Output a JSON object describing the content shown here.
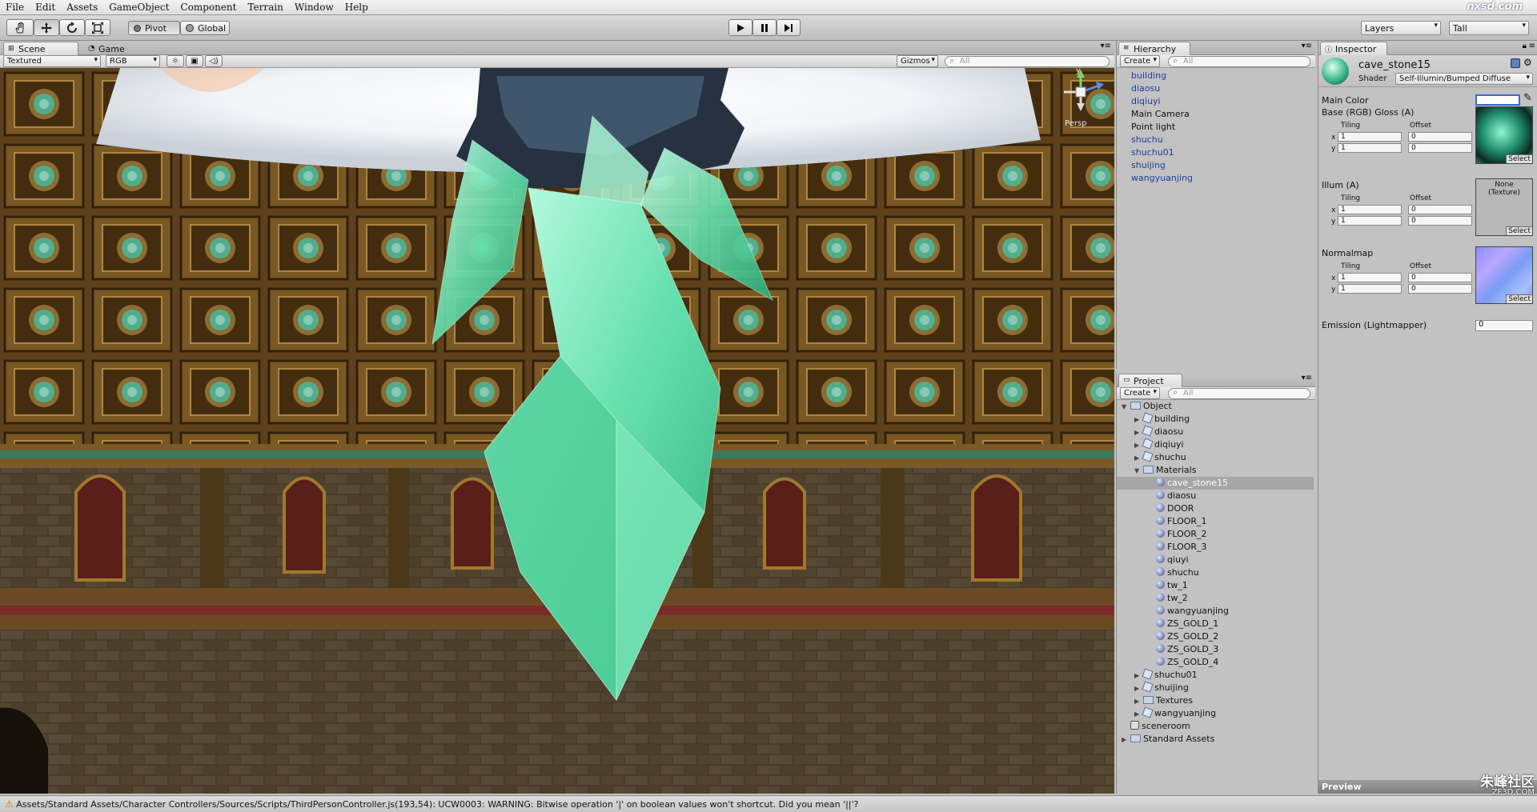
{
  "menu": [
    "File",
    "Edit",
    "Assets",
    "GameObject",
    "Component",
    "Terrain",
    "Window",
    "Help"
  ],
  "toolbar": {
    "pivot_label": "Pivot",
    "global_label": "Global",
    "layers_label": "Layers",
    "layout_label": "Tall"
  },
  "scene": {
    "tab_scene": "Scene",
    "tab_game": "Game",
    "render_mode": "Textured",
    "color_mode": "RGB",
    "gizmos_label": "Gizmos",
    "search_placeholder": "All",
    "gizmo_persp": "Persp",
    "gizmo_axis_y": "y"
  },
  "hierarchy": {
    "title": "Hierarchy",
    "create_label": "Create",
    "search_placeholder": "All",
    "items": [
      {
        "label": "building",
        "prefab": true
      },
      {
        "label": "diaosu",
        "prefab": true
      },
      {
        "label": "diqiuyi",
        "prefab": true
      },
      {
        "label": "Main Camera",
        "prefab": false
      },
      {
        "label": "Point light",
        "prefab": false
      },
      {
        "label": "shuchu",
        "prefab": true
      },
      {
        "label": "shuchu01",
        "prefab": true
      },
      {
        "label": "shuijing",
        "prefab": true
      },
      {
        "label": "wangyuanjing",
        "prefab": true
      }
    ]
  },
  "project": {
    "title": "Project",
    "create_label": "Create",
    "search_placeholder": "All",
    "tree": [
      {
        "label": "Object",
        "type": "folder",
        "depth": 0,
        "arrow": "open"
      },
      {
        "label": "building",
        "type": "prefab",
        "depth": 1,
        "arrow": "closed"
      },
      {
        "label": "diaosu",
        "type": "prefab",
        "depth": 1,
        "arrow": "closed"
      },
      {
        "label": "diqiuyi",
        "type": "prefab",
        "depth": 1,
        "arrow": "closed"
      },
      {
        "label": "shuchu",
        "type": "prefab",
        "depth": 1,
        "arrow": "closed"
      },
      {
        "label": "Materials",
        "type": "folder",
        "depth": 1,
        "arrow": "open"
      },
      {
        "label": "cave_stone15",
        "type": "material",
        "depth": 2,
        "arrow": "",
        "selected": true
      },
      {
        "label": "diaosu",
        "type": "material",
        "depth": 2,
        "arrow": ""
      },
      {
        "label": "DOOR",
        "type": "material",
        "depth": 2,
        "arrow": ""
      },
      {
        "label": "FLOOR_1",
        "type": "material",
        "depth": 2,
        "arrow": ""
      },
      {
        "label": "FLOOR_2",
        "type": "material",
        "depth": 2,
        "arrow": ""
      },
      {
        "label": "FLOOR_3",
        "type": "material",
        "depth": 2,
        "arrow": ""
      },
      {
        "label": "qiuyi",
        "type": "material",
        "depth": 2,
        "arrow": ""
      },
      {
        "label": "shuchu",
        "type": "material",
        "depth": 2,
        "arrow": ""
      },
      {
        "label": "tw_1",
        "type": "material",
        "depth": 2,
        "arrow": ""
      },
      {
        "label": "tw_2",
        "type": "material",
        "depth": 2,
        "arrow": ""
      },
      {
        "label": "wangyuanjing",
        "type": "material",
        "depth": 2,
        "arrow": ""
      },
      {
        "label": "ZS_GOLD_1",
        "type": "material",
        "depth": 2,
        "arrow": ""
      },
      {
        "label": "ZS_GOLD_2",
        "type": "material",
        "depth": 2,
        "arrow": ""
      },
      {
        "label": "ZS_GOLD_3",
        "type": "material",
        "depth": 2,
        "arrow": ""
      },
      {
        "label": "ZS_GOLD_4",
        "type": "material",
        "depth": 2,
        "arrow": ""
      },
      {
        "label": "shuchu01",
        "type": "prefab",
        "depth": 1,
        "arrow": "closed"
      },
      {
        "label": "shuijing",
        "type": "prefab",
        "depth": 1,
        "arrow": "closed"
      },
      {
        "label": "Textures",
        "type": "folder",
        "depth": 1,
        "arrow": "closed"
      },
      {
        "label": "wangyuanjing",
        "type": "prefab",
        "depth": 1,
        "arrow": "closed"
      },
      {
        "label": "sceneroom",
        "type": "scene",
        "depth": 0,
        "arrow": ""
      },
      {
        "label": "Standard Assets",
        "type": "folder",
        "depth": 0,
        "arrow": "closed"
      }
    ]
  },
  "inspector": {
    "title": "Inspector",
    "material_name": "cave_stone15",
    "shader_label": "Shader",
    "shader_value": "Self-Illumin/Bumped Diffuse",
    "main_color_label": "Main Color",
    "tiling_label": "Tiling",
    "offset_label": "Offset",
    "x_label": "x",
    "y_label": "y",
    "select_label": "Select",
    "props": [
      {
        "label": "Base (RGB) Gloss (A)",
        "tx": "1",
        "ty": "1",
        "ox": "0",
        "oy": "0",
        "thumb": "crystal"
      },
      {
        "label": "Illum (A)",
        "tx": "1",
        "ty": "1",
        "ox": "0",
        "oy": "0",
        "thumb": "none",
        "none_text": "None\n(Texture)"
      },
      {
        "label": "Normalmap",
        "tx": "1",
        "ty": "1",
        "ox": "0",
        "oy": "0",
        "thumb": "normal"
      }
    ],
    "emission_label": "Emission (Lightmapper)",
    "emission_value": "0",
    "preview_label": "Preview"
  },
  "status": {
    "message": "Assets/Standard Assets/Character Controllers/Sources/Scripts/ThirdPersonController.js(193,54): UCW0003: WARNING: Bitwise operation '|' on boolean values won't shortcut. Did you mean '||'?"
  },
  "watermarks": {
    "top_right": "nxsd.com",
    "bottom_right_cn": "朱峰社区",
    "bottom_right_en": "ZF3D.COM"
  }
}
